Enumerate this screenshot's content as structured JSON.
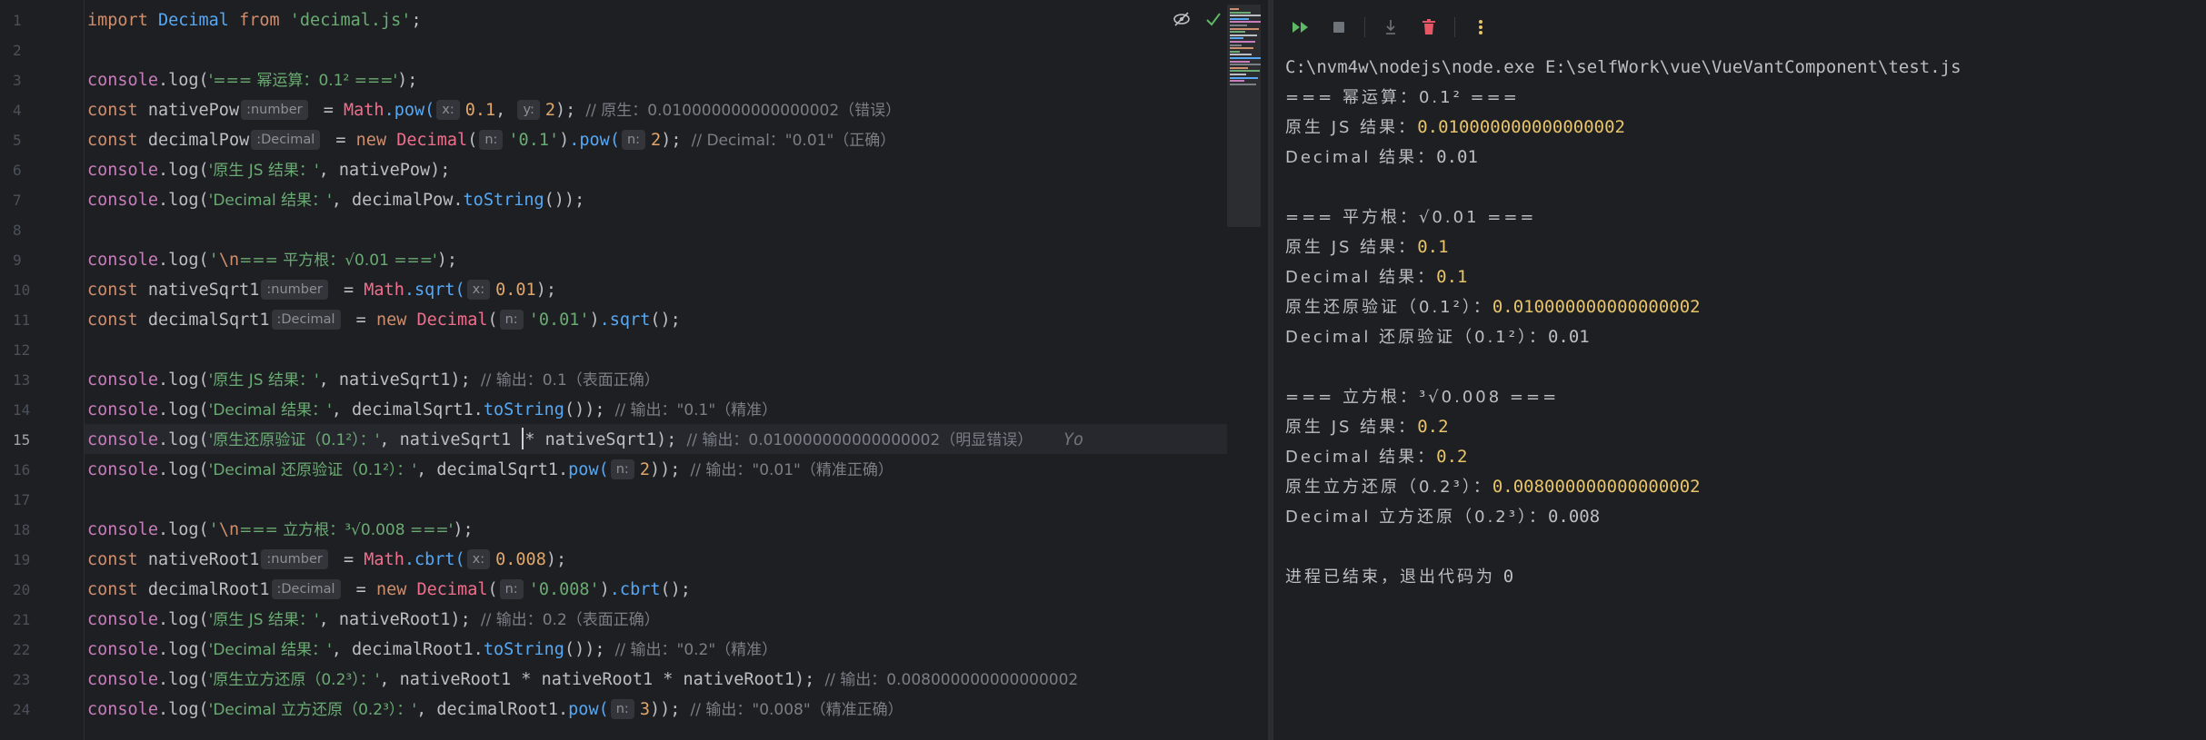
{
  "editor": {
    "line_numbers": [
      "1",
      "2",
      "3",
      "4",
      "5",
      "6",
      "7",
      "8",
      "9",
      "10",
      "11",
      "12",
      "13",
      "14",
      "15",
      "16",
      "17",
      "18",
      "19",
      "20",
      "21",
      "22",
      "23",
      "24"
    ],
    "current_line": 15,
    "tokens": {
      "import_kw": "import",
      "decimal_cls": "Decimal",
      "from_kw": "from",
      "module_str": "'decimal.js'",
      "semi": ";",
      "console": "console",
      "dotlog": ".log(",
      "close": ");",
      "const": "const",
      "new": "new",
      "math": "Math",
      "eq": " = ",
      "hint_number": ":number",
      "hint_decimal": ":Decimal",
      "hint_x": "x:",
      "hint_y": "y:",
      "hint_n": "n:"
    },
    "lines": {
      "l3_str": "'=== 幂运算：0.1² ==='",
      "l4_name": "nativePow",
      "l4_fn": ".pow(",
      "l4_a": "0.1",
      "l4_comma": ", ",
      "l4_b": "2",
      "l4_end": ");",
      "l4_cm": "// 原生：0.010000000000000002（错误）",
      "l5_name": "decimalPow",
      "l5_s": "'0.1'",
      "l5_pow": ".pow(",
      "l5_b": "2",
      "l5_end": ");",
      "l5_cm": "// Decimal：\"0.01\"（正确）",
      "l6_str": "'原生 JS 结果：'",
      "l6_rest": ", nativePow);",
      "l7_str": "'Decimal 结果：'",
      "l7_rest1": ", decimalPow.",
      "l7_fn": "toString",
      "l7_rest2": "());",
      "l9_str1": "'",
      "l9_esc": "\\n",
      "l9_str2": "=== 平方根：√0.01 ==='",
      "l10_name": "nativeSqrt1",
      "l10_fn": ".sqrt(",
      "l10_a": "0.01",
      "l10_end": ");",
      "l11_name": "decimalSqrt1",
      "l11_s": "'0.01'",
      "l11_fn": ".sqrt",
      "l11_end": "();",
      "l13_str": "'原生 JS 结果：'",
      "l13_rest": ", nativeSqrt1);",
      "l13_cm": "// 输出：0.1（表面正确）",
      "l14_str": "'Decimal 结果：'",
      "l14_rest1": ", decimalSqrt1.",
      "l14_fn": "toString",
      "l14_rest2": "());",
      "l14_cm": "// 输出：\"0.1\"（精准）",
      "l15_str": "'原生还原验证（0.1²）：'",
      "l15_rest1": ", nativeSqrt1 ",
      "l15_rest2": "* nativeSqrt1);",
      "l15_cm": "// 输出：0.010000000000000002（明显错误）",
      "l15_inlay": "Yo",
      "l16_str": "'Decimal 还原验证（0.1²）：'",
      "l16_rest1": ", decimalSqrt1.",
      "l16_fn": "pow(",
      "l16_b": "2",
      "l16_end": "));",
      "l16_cm": "// 输出：\"0.01\"（精准正确）",
      "l18_str1": "'",
      "l18_esc": "\\n",
      "l18_str2": "=== 立方根：³√0.008 ==='",
      "l19_name": "nativeRoot1",
      "l19_fn": ".cbrt(",
      "l19_a": "0.008",
      "l19_end": ");",
      "l20_name": "decimalRoot1",
      "l20_s": "'0.008'",
      "l20_fn": ".cbrt",
      "l20_end": "();",
      "l21_str": "'原生 JS 结果：'",
      "l21_rest": ", nativeRoot1);",
      "l21_cm": "// 输出：0.2（表面正确）",
      "l22_str": "'Decimal 结果：'",
      "l22_rest1": ", decimalRoot1.",
      "l22_fn": "toString",
      "l22_rest2": "());",
      "l22_cm": "// 输出：\"0.2\"（精准）",
      "l23_str": "'原生立方还原（0.2³）：'",
      "l23_rest": ", nativeRoot1 * nativeRoot1 * nativeRoot1);",
      "l23_cm": "// 输出：0.008000000000000002",
      "l24_str": "'Decimal 立方还原（0.2³）：'",
      "l24_rest1": ", decimalRoot1.",
      "l24_fn": "pow(",
      "l24_b": "3",
      "l24_end": "));",
      "l24_cm": "// 输出：\"0.008\"（精准正确）"
    }
  },
  "console": {
    "command": "C:\\nvm4w\\nodejs\\node.exe E:\\selfWork\\vue\\VueVantComponent\\test.js",
    "lines": [
      {
        "label": "=== 幂运算：0.1² ===",
        "value": ""
      },
      {
        "label": "原生 JS 结果：",
        "value": "0.010000000000000002"
      },
      {
        "label": "Decimal 结果：",
        "value": "0.01"
      },
      {
        "label": "",
        "value": ""
      },
      {
        "label": "=== 平方根：√0.01 ===",
        "value": ""
      },
      {
        "label": "原生 JS 结果：",
        "value": "0.1"
      },
      {
        "label": "Decimal 结果：",
        "value": "0.1"
      },
      {
        "label": "原生还原验证（0.1²）：",
        "value": "0.010000000000000002"
      },
      {
        "label": "Decimal 还原验证（0.1²）：",
        "value": "0.01"
      },
      {
        "label": "",
        "value": ""
      },
      {
        "label": "=== 立方根：³√0.008 ===",
        "value": ""
      },
      {
        "label": "原生 JS 结果：",
        "value": "0.2"
      },
      {
        "label": "Decimal 结果：",
        "value": "0.2"
      },
      {
        "label": "原生立方还原（0.2³）：",
        "value": "0.008000000000000002"
      },
      {
        "label": "Decimal 立方还原（0.2³）：",
        "value": "0.008"
      },
      {
        "label": "",
        "value": ""
      },
      {
        "label": "进程已结束，退出代码为 ",
        "value": "0"
      }
    ]
  },
  "colors": {
    "rerun": "#5fb865",
    "stop": "#6f737a",
    "delete": "#e55765",
    "more": "#e8c46a"
  },
  "icons": [
    "inlay-hide-icon",
    "check-icon",
    "rerun-icon",
    "stop-icon",
    "scroll-to-end-icon",
    "trash-icon",
    "more-vertical-icon"
  ]
}
